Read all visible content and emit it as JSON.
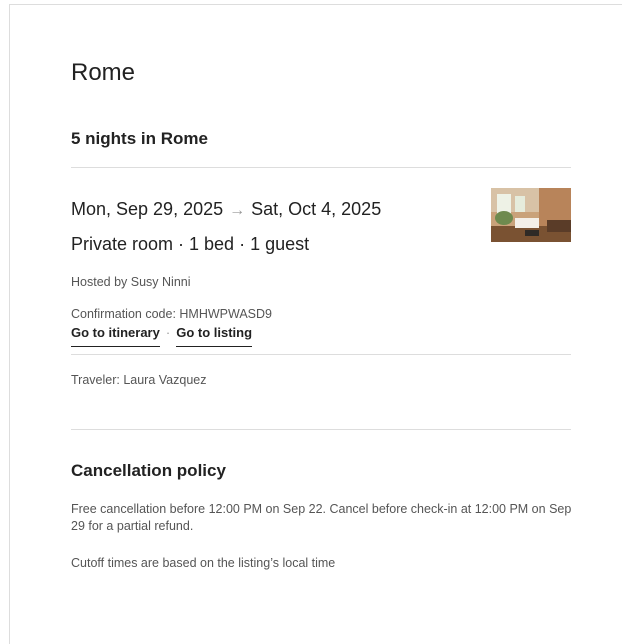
{
  "trip": {
    "city": "Rome",
    "nights_heading": "5 nights in Rome",
    "check_in": "Mon, Sep 29, 2025",
    "arrow_icon": "→",
    "check_out": "Sat, Oct 4, 2025",
    "room_summary": "Private room · 1 bed · 1 guest",
    "host": "Hosted by Susy Ninni",
    "confirmation": "Confirmation code: HMHWPWASD9",
    "itinerary_link": "Go to itinerary",
    "link_separator": "·",
    "listing_link": "Go to listing",
    "traveler": "Traveler: Laura Vazquez"
  },
  "cancellation": {
    "title": "Cancellation policy",
    "text": "Free cancellation before 12:00 PM on Sep 22. Cancel before check-in at 12:00 PM on Sep 29 for a partial refund.",
    "cutoff_note": "Cutoff times are based on the listing’s local time"
  },
  "colors": {
    "text": "#222222",
    "muted": "#555555",
    "divider": "#dddddd"
  }
}
